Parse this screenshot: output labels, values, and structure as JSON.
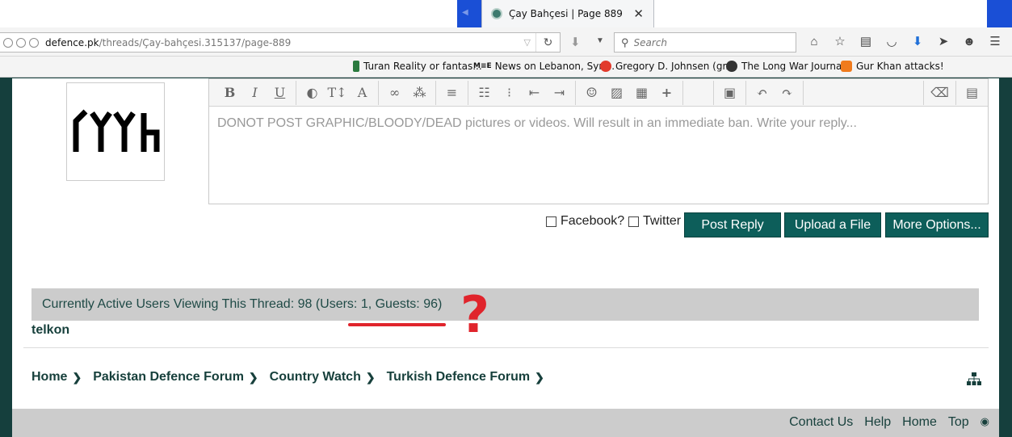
{
  "browser": {
    "tab_title": "Çay Bahçesi | Page 889",
    "url_domain": "defence.pk",
    "url_path": "/threads/Çay-bahçesi.315137/page-889",
    "search_placeholder": "Search",
    "bookmarks": [
      "Turan Reality or fantas...",
      "News on Lebanon, Syri...",
      "Gregory D. Johnsen (gr...",
      "The Long War Journal",
      "Gur Khan attacks!"
    ],
    "bookmark_badges": {
      "mee": "M≡E"
    }
  },
  "editor": {
    "placeholder": "DONOT POST GRAPHIC/BLOODY/DEAD pictures or videos. Will result in an immediate ban. Write your reply..."
  },
  "share": {
    "facebook_label": "Facebook?",
    "twitter_label": "Twitter"
  },
  "buttons": {
    "post_reply": "Post Reply",
    "upload_file": "Upload a File",
    "more_options": "More Options..."
  },
  "active_users": {
    "text": "Currently Active Users Viewing This Thread: 98 (Users: 1, Guests: 96)",
    "users": [
      "telkon"
    ]
  },
  "annotation": {
    "mark": "?"
  },
  "breadcrumb": [
    "Home",
    "Pakistan Defence Forum",
    "Country Watch",
    "Turkish Defence Forum"
  ],
  "footer": {
    "links": [
      "Contact Us",
      "Help",
      "Home",
      "Top"
    ]
  },
  "colors": {
    "accent": "#0d5e5a",
    "annotation": "#e0242c",
    "background": "#153f3d"
  }
}
